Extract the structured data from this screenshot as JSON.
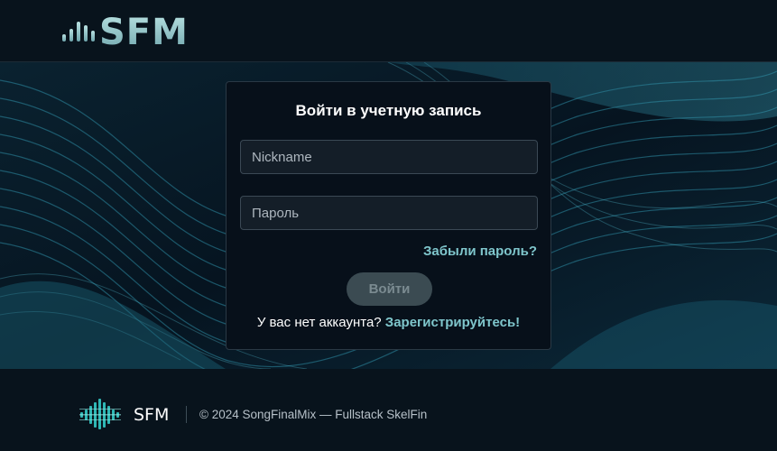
{
  "header": {
    "logo_text": "SFM",
    "logo_icon": "equalizer-bars-icon"
  },
  "login": {
    "title": "Войти в учетную запись",
    "nickname_placeholder": "Nickname",
    "nickname_value": "",
    "password_placeholder": "Пароль",
    "password_value": "",
    "forgot_label": "Забыли пароль?",
    "submit_label": "Войти",
    "no_account_text": "У вас нет аккаунта?",
    "register_label": "Зарегистрируйтесь!"
  },
  "footer": {
    "brand": "SFM",
    "copyright": "© 2024 SongFinalMix — Fullstack SkelFin",
    "logo_icon": "waveform-logo-icon"
  },
  "colors": {
    "accent": "#7fc6cc",
    "background": "#081019",
    "card": "#07101a",
    "button_disabled": "#3b4b52"
  }
}
